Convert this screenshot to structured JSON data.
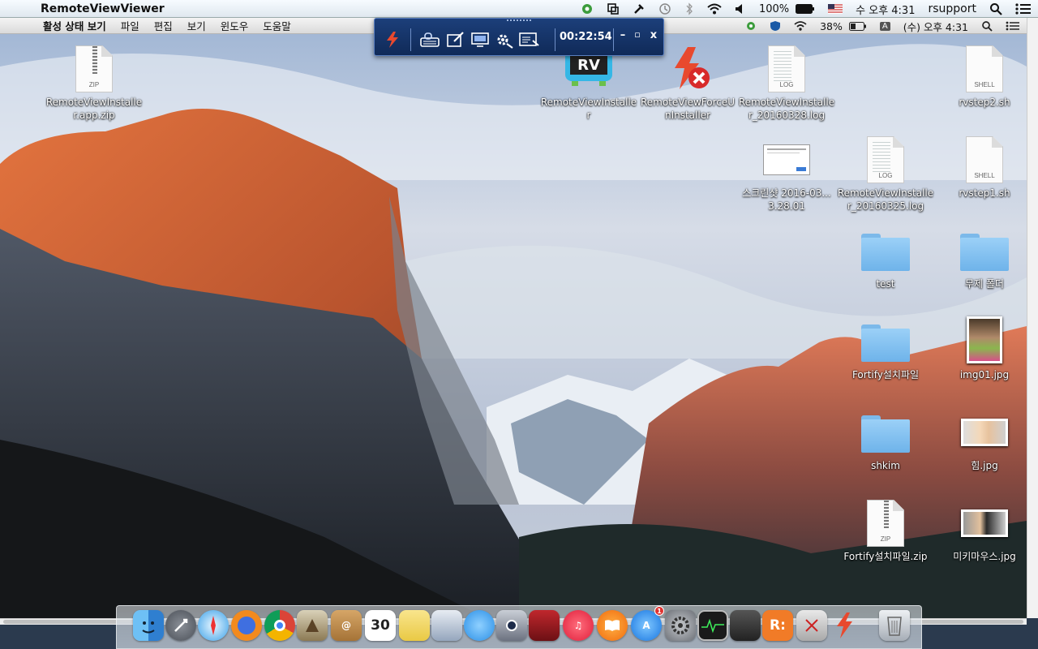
{
  "host_menubar": {
    "app_name": "RemoteViewViewer",
    "battery": "100%",
    "clock": "수 오후 4:31",
    "user": "rsupport",
    "icons": [
      "apple-icon",
      "evernote-icon",
      "display-icon",
      "tools-icon",
      "time-machine-icon",
      "bluetooth-icon",
      "wifi-icon",
      "volume-icon",
      "battery-icon",
      "us-flag-icon",
      "spotlight-icon",
      "notification-center-icon"
    ]
  },
  "inner_menubar": {
    "items": [
      "활성 상태 보기",
      "파일",
      "편집",
      "보기",
      "윈도우",
      "도움말"
    ],
    "battery": "38%",
    "input_source": "A",
    "clock": "(수) 오후 4:31"
  },
  "rv_toolbar": {
    "timer": "00:22:54",
    "buttons": [
      "rsupport-logo-icon",
      "keyboard-lock-icon",
      "draw-icon",
      "screen-icon",
      "settings-icon",
      "window-select-icon"
    ],
    "minimize": "–",
    "restore": "▫",
    "close": "x"
  },
  "desktop_icons": [
    {
      "id": "zip1",
      "label": "RemoteViewInstaller.app.zip",
      "type": "zip",
      "tag": "ZIP"
    },
    {
      "id": "rvapp",
      "label": "RemoteViewInstaller",
      "type": "app",
      "tag": "RV"
    },
    {
      "id": "forceun",
      "label": "RemoteViewForceUnInstaller",
      "type": "app"
    },
    {
      "id": "log1",
      "label": "RemoteViewInstaller_20160328.log",
      "type": "doc",
      "tag": "LOG"
    },
    {
      "id": "sh2",
      "label": "rvstep2.sh",
      "type": "doc",
      "tag": "SHELL"
    },
    {
      "id": "shot",
      "label": "스크린샷 2016-03...3.28.01",
      "type": "screenshot"
    },
    {
      "id": "log2",
      "label": "RemoteViewInstaller_20160325.log",
      "type": "doc",
      "tag": "LOG"
    },
    {
      "id": "sh1",
      "label": "rvstep1.sh",
      "type": "doc",
      "tag": "SHELL"
    },
    {
      "id": "test",
      "label": "test",
      "type": "folder"
    },
    {
      "id": "untitled",
      "label": "무제 폴더",
      "type": "folder"
    },
    {
      "id": "fortify",
      "label": "Fortify설치파일",
      "type": "folder"
    },
    {
      "id": "img01",
      "label": "img01.jpg",
      "type": "photo"
    },
    {
      "id": "shkim",
      "label": "shkim",
      "type": "folder"
    },
    {
      "id": "him",
      "label": "힘.jpg",
      "type": "photo"
    },
    {
      "id": "fortifyzip",
      "label": "Fortify설치파일.zip",
      "type": "zip",
      "tag": "ZIP"
    },
    {
      "id": "mickey",
      "label": "미키마우스.jpg",
      "type": "photo"
    }
  ],
  "dock": {
    "apps": [
      "finder-icon",
      "launchpad-icon",
      "safari-icon",
      "firefox-icon",
      "chrome-icon",
      "preview-icon",
      "contacts-icon",
      "calendar-icon",
      "notes-icon",
      "sysinfo-icon",
      "messages-icon",
      "facetime-icon",
      "photo-booth-icon",
      "itunes-icon",
      "ibooks-icon",
      "app-store-icon",
      "system-preferences-icon",
      "activity-monitor-icon",
      "terminal-icon",
      "remoteview-icon",
      "scissors-icon",
      "rsupport-icon",
      "trash-icon"
    ],
    "calendar_day": "30",
    "app_store_badge": "1",
    "rv_label": "R:"
  },
  "colors": {
    "toolbar": "#142f63",
    "folder": "#7cbbee",
    "sky": "#c9d4e4"
  }
}
